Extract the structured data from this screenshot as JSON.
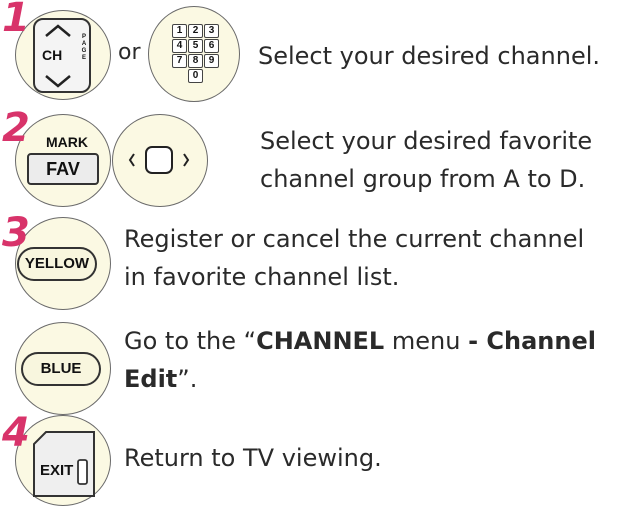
{
  "steps": [
    {
      "number": "1",
      "keys": [
        {
          "label": "CH",
          "side": "PAGE"
        },
        {
          "numbers": [
            "1",
            "2",
            "3",
            "4",
            "5",
            "6",
            "7",
            "8",
            "9",
            "0"
          ]
        }
      ],
      "or_label": "or",
      "text": "Select your desired channel."
    },
    {
      "number": "2",
      "keys": [
        {
          "top": "MARK",
          "label": "FAV"
        },
        {
          "icon": "arrow-pad"
        }
      ],
      "text_line1": "Select your desired favorite",
      "text_line2": "channel group from A to D."
    },
    {
      "number": "3",
      "keys": [
        {
          "label": "YELLOW"
        }
      ],
      "text_line1": "Register or cancel the current channel",
      "text_line2": "in favorite channel list."
    },
    {
      "number": "",
      "keys": [
        {
          "label": "BLUE"
        }
      ],
      "text_part1": "Go to the “",
      "text_bold1": "CHANNEL",
      "text_part2": " menu ",
      "text_bold2": "- Channel",
      "text_bold3": "Edit",
      "text_part3": "”."
    },
    {
      "number": "4",
      "keys": [
        {
          "label": "EXIT"
        }
      ],
      "text": "Return to TV viewing."
    }
  ],
  "colors": {
    "step_number": "#d8336a",
    "circle_fill": "#fbf9e3"
  }
}
